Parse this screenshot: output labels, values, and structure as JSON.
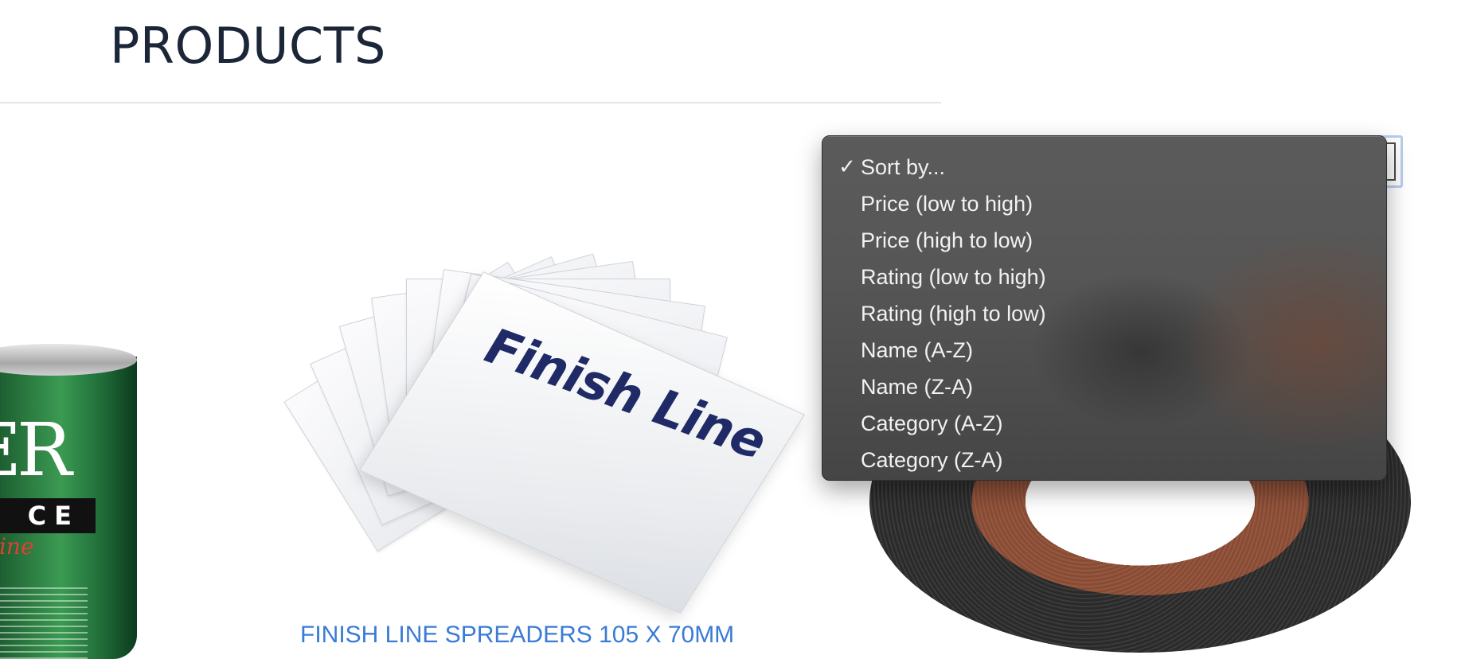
{
  "page": {
    "title": "PRODUCTS"
  },
  "products": [
    {
      "name": "FINISH LINE SPREADERS 105 X 70MM",
      "image_text": "Finish Line"
    }
  ],
  "can_label": {
    "logo": "ER",
    "band": "CE",
    "script": "line"
  },
  "sort": {
    "selected": "Sort by...",
    "options": [
      {
        "label": "Sort by...",
        "checked": true
      },
      {
        "label": "Price (low to high)",
        "checked": false
      },
      {
        "label": "Price (high to low)",
        "checked": false
      },
      {
        "label": "Rating (low to high)",
        "checked": false
      },
      {
        "label": "Rating (high to low)",
        "checked": false
      },
      {
        "label": "Name (A-Z)",
        "checked": false
      },
      {
        "label": "Name (Z-A)",
        "checked": false
      },
      {
        "label": "Category (A-Z)",
        "checked": false
      },
      {
        "label": "Category (Z-A)",
        "checked": false
      }
    ],
    "check_glyph": "✓"
  },
  "colors": {
    "title": "#1b2638",
    "link": "#3a7bd5",
    "menu_bg": "#555555",
    "menu_text": "#f2f2f2",
    "focus_ring": "#b8cdf0"
  }
}
